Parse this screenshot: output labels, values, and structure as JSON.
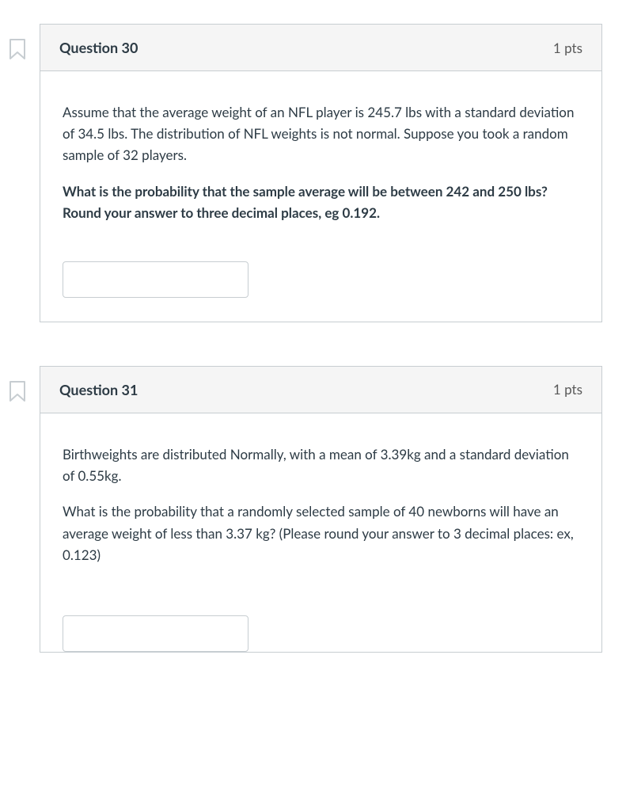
{
  "questions": [
    {
      "title": "Question 30",
      "points": "1 pts",
      "context": "Assume that the average weight of an NFL player is 245.7 lbs with a standard deviation of 34.5 lbs. The distribution of NFL weights is not normal. Suppose you took a random sample of 32 players.",
      "prompt": "What is the probability that the sample average will be between 242 and 250 lbs? Round your answer to three decimal places, eg 0.192.",
      "answer_value": ""
    },
    {
      "title": "Question 31",
      "points": "1 pts",
      "context": "Birthweights are distributed Normally, with a mean of 3.39kg and a standard deviation of 0.55kg.",
      "prompt_plain": "What is the probability that a randomly selected sample of 40 newborns will have an average weight of less than 3.37 kg? (Please round your answer to 3 decimal places: ex, 0.123)",
      "answer_value": ""
    }
  ]
}
